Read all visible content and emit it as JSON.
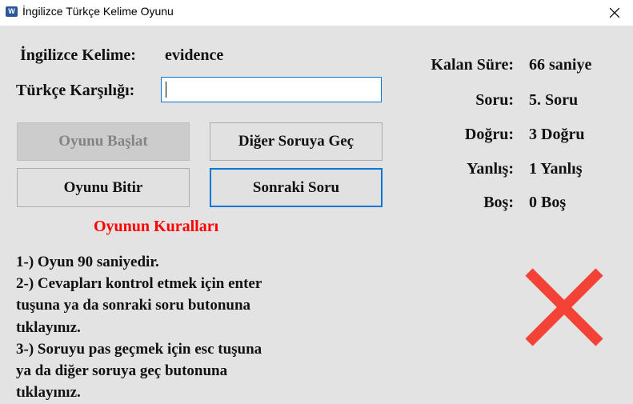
{
  "window": {
    "title": "İngilizce Türkçe Kelime Oyunu",
    "icon": "word-app-icon",
    "icon_letter": "W"
  },
  "left": {
    "english_label": "İngilizce Kelime:",
    "english_word": "evidence",
    "turkish_label": "Türkçe Karşılığı:",
    "turkish_input_value": ""
  },
  "buttons": {
    "start": "Oyunu Başlat",
    "skip": "Diğer Soruya Geç",
    "finish": "Oyunu Bitir",
    "next": "Sonraki Soru"
  },
  "rules": {
    "title": "Oyunun Kuralları",
    "title_color": "#ff0000",
    "lines": [
      "1-) Oyun 90 saniyedir.",
      "2-) Cevapları kontrol etmek için enter",
      "tuşuna ya da sonraki soru butonuna",
      "tıklayınız.",
      "3-) Soruyu pas geçmek için esc tuşuna",
      "ya da diğer soruya geç butonuna",
      "tıklayınız."
    ]
  },
  "status": {
    "time_label": "Kalan Süre:",
    "time_value": "66 saniye",
    "question_label": "Soru:",
    "question_value": "5. Soru",
    "correct_label": "Doğru:",
    "correct_value": "3 Doğru",
    "wrong_label": "Yanlış:",
    "wrong_value": "1 Yanlış",
    "empty_label": "Boş:",
    "empty_value": "0 Boş"
  },
  "result": {
    "icon": "wrong-answer-x-icon",
    "color": "#f44336"
  }
}
